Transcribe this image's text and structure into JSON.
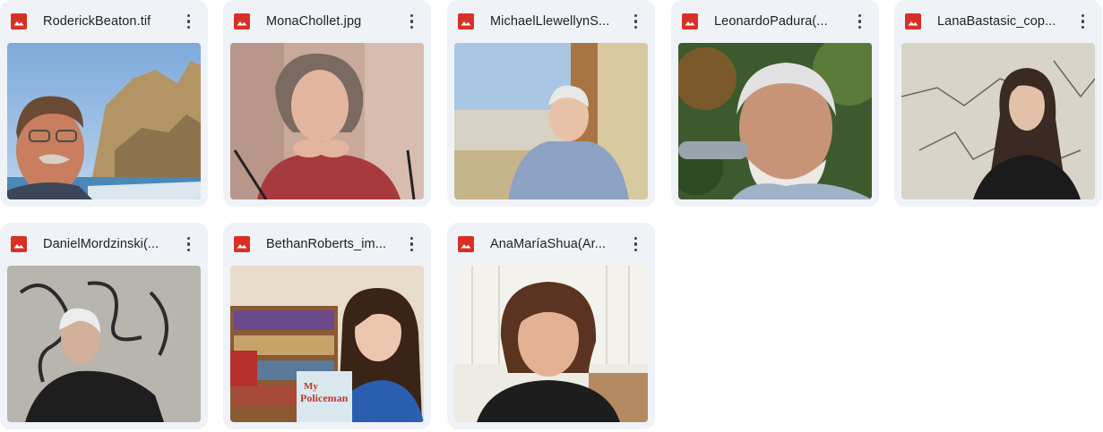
{
  "files": [
    {
      "name": "RoderickBeaton.tif",
      "icon": "image-file-icon"
    },
    {
      "name": "MonaChollet.jpg",
      "icon": "image-file-icon"
    },
    {
      "name": "MichaelLlewellynS...",
      "icon": "image-file-icon"
    },
    {
      "name": "LeonardoPadura(...",
      "icon": "image-file-icon"
    },
    {
      "name": "LanaBastasic_cop...",
      "icon": "image-file-icon"
    },
    {
      "name": "DanielMordzinski(...",
      "icon": "image-file-icon"
    },
    {
      "name": "BethanRoberts_im...",
      "icon": "image-file-icon"
    },
    {
      "name": "AnaMaríaShua(Ar...",
      "icon": "image-file-icon"
    }
  ],
  "thumbnail_texts": {
    "book_cover_title": "Policeman",
    "book_cover_prefix": "My"
  },
  "colors": {
    "card_bg": "#eff3f8",
    "image_icon_red": "#d93025"
  }
}
